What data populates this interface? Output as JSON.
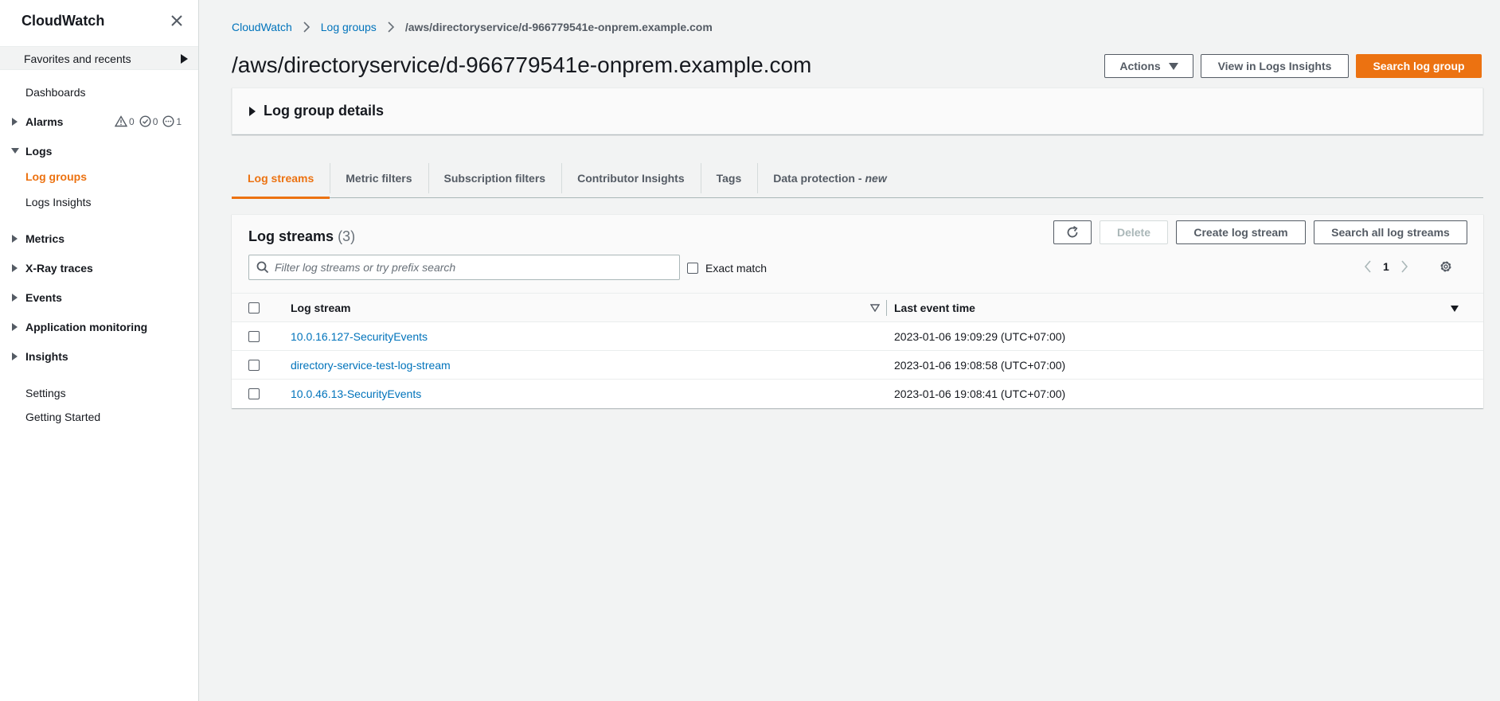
{
  "sidebar": {
    "title": "CloudWatch",
    "favorites_label": "Favorites and recents",
    "dashboards": "Dashboards",
    "alarms": "Alarms",
    "alarm_counts": {
      "alarm": "0",
      "ok": "0",
      "insufficient": "1"
    },
    "logs": "Logs",
    "log_groups": "Log groups",
    "logs_insights": "Logs Insights",
    "metrics": "Metrics",
    "xray": "X-Ray traces",
    "events": "Events",
    "app_monitoring": "Application monitoring",
    "insights": "Insights",
    "settings": "Settings",
    "getting_started": "Getting Started"
  },
  "breadcrumb": {
    "root": "CloudWatch",
    "parent": "Log groups",
    "current": "/aws/directoryservice/d-966779541e-onprem.example.com"
  },
  "page": {
    "title": "/aws/directoryservice/d-966779541e-onprem.example.com"
  },
  "header_buttons": {
    "actions": "Actions",
    "view_insights": "View in Logs Insights",
    "search_group": "Search log group"
  },
  "details": {
    "label": "Log group details"
  },
  "tabs": {
    "log_streams": "Log streams",
    "metric_filters": "Metric filters",
    "subscription_filters": "Subscription filters",
    "contributor_insights": "Contributor Insights",
    "tags": "Tags",
    "data_protection": "Data protection -",
    "data_protection_new": "new"
  },
  "streams": {
    "title": "Log streams",
    "count": "(3)",
    "delete": "Delete",
    "create": "Create log stream",
    "search_all": "Search all log streams",
    "filter_placeholder": "Filter log streams or try prefix search",
    "exact_match": "Exact match",
    "page": "1",
    "columns": {
      "name": "Log stream",
      "time": "Last event time"
    },
    "rows": [
      {
        "name": "10.0.16.127-SecurityEvents",
        "time": "2023-01-06 19:09:29 (UTC+07:00)"
      },
      {
        "name": "directory-service-test-log-stream",
        "time": "2023-01-06 19:08:58 (UTC+07:00)"
      },
      {
        "name": "10.0.46.13-SecurityEvents",
        "time": "2023-01-06 19:08:41 (UTC+07:00)"
      }
    ]
  },
  "colors": {
    "accent": "#ec7211",
    "link": "#0073bb",
    "text": "#16191f",
    "muted": "#545b64",
    "background": "#f2f3f3"
  }
}
